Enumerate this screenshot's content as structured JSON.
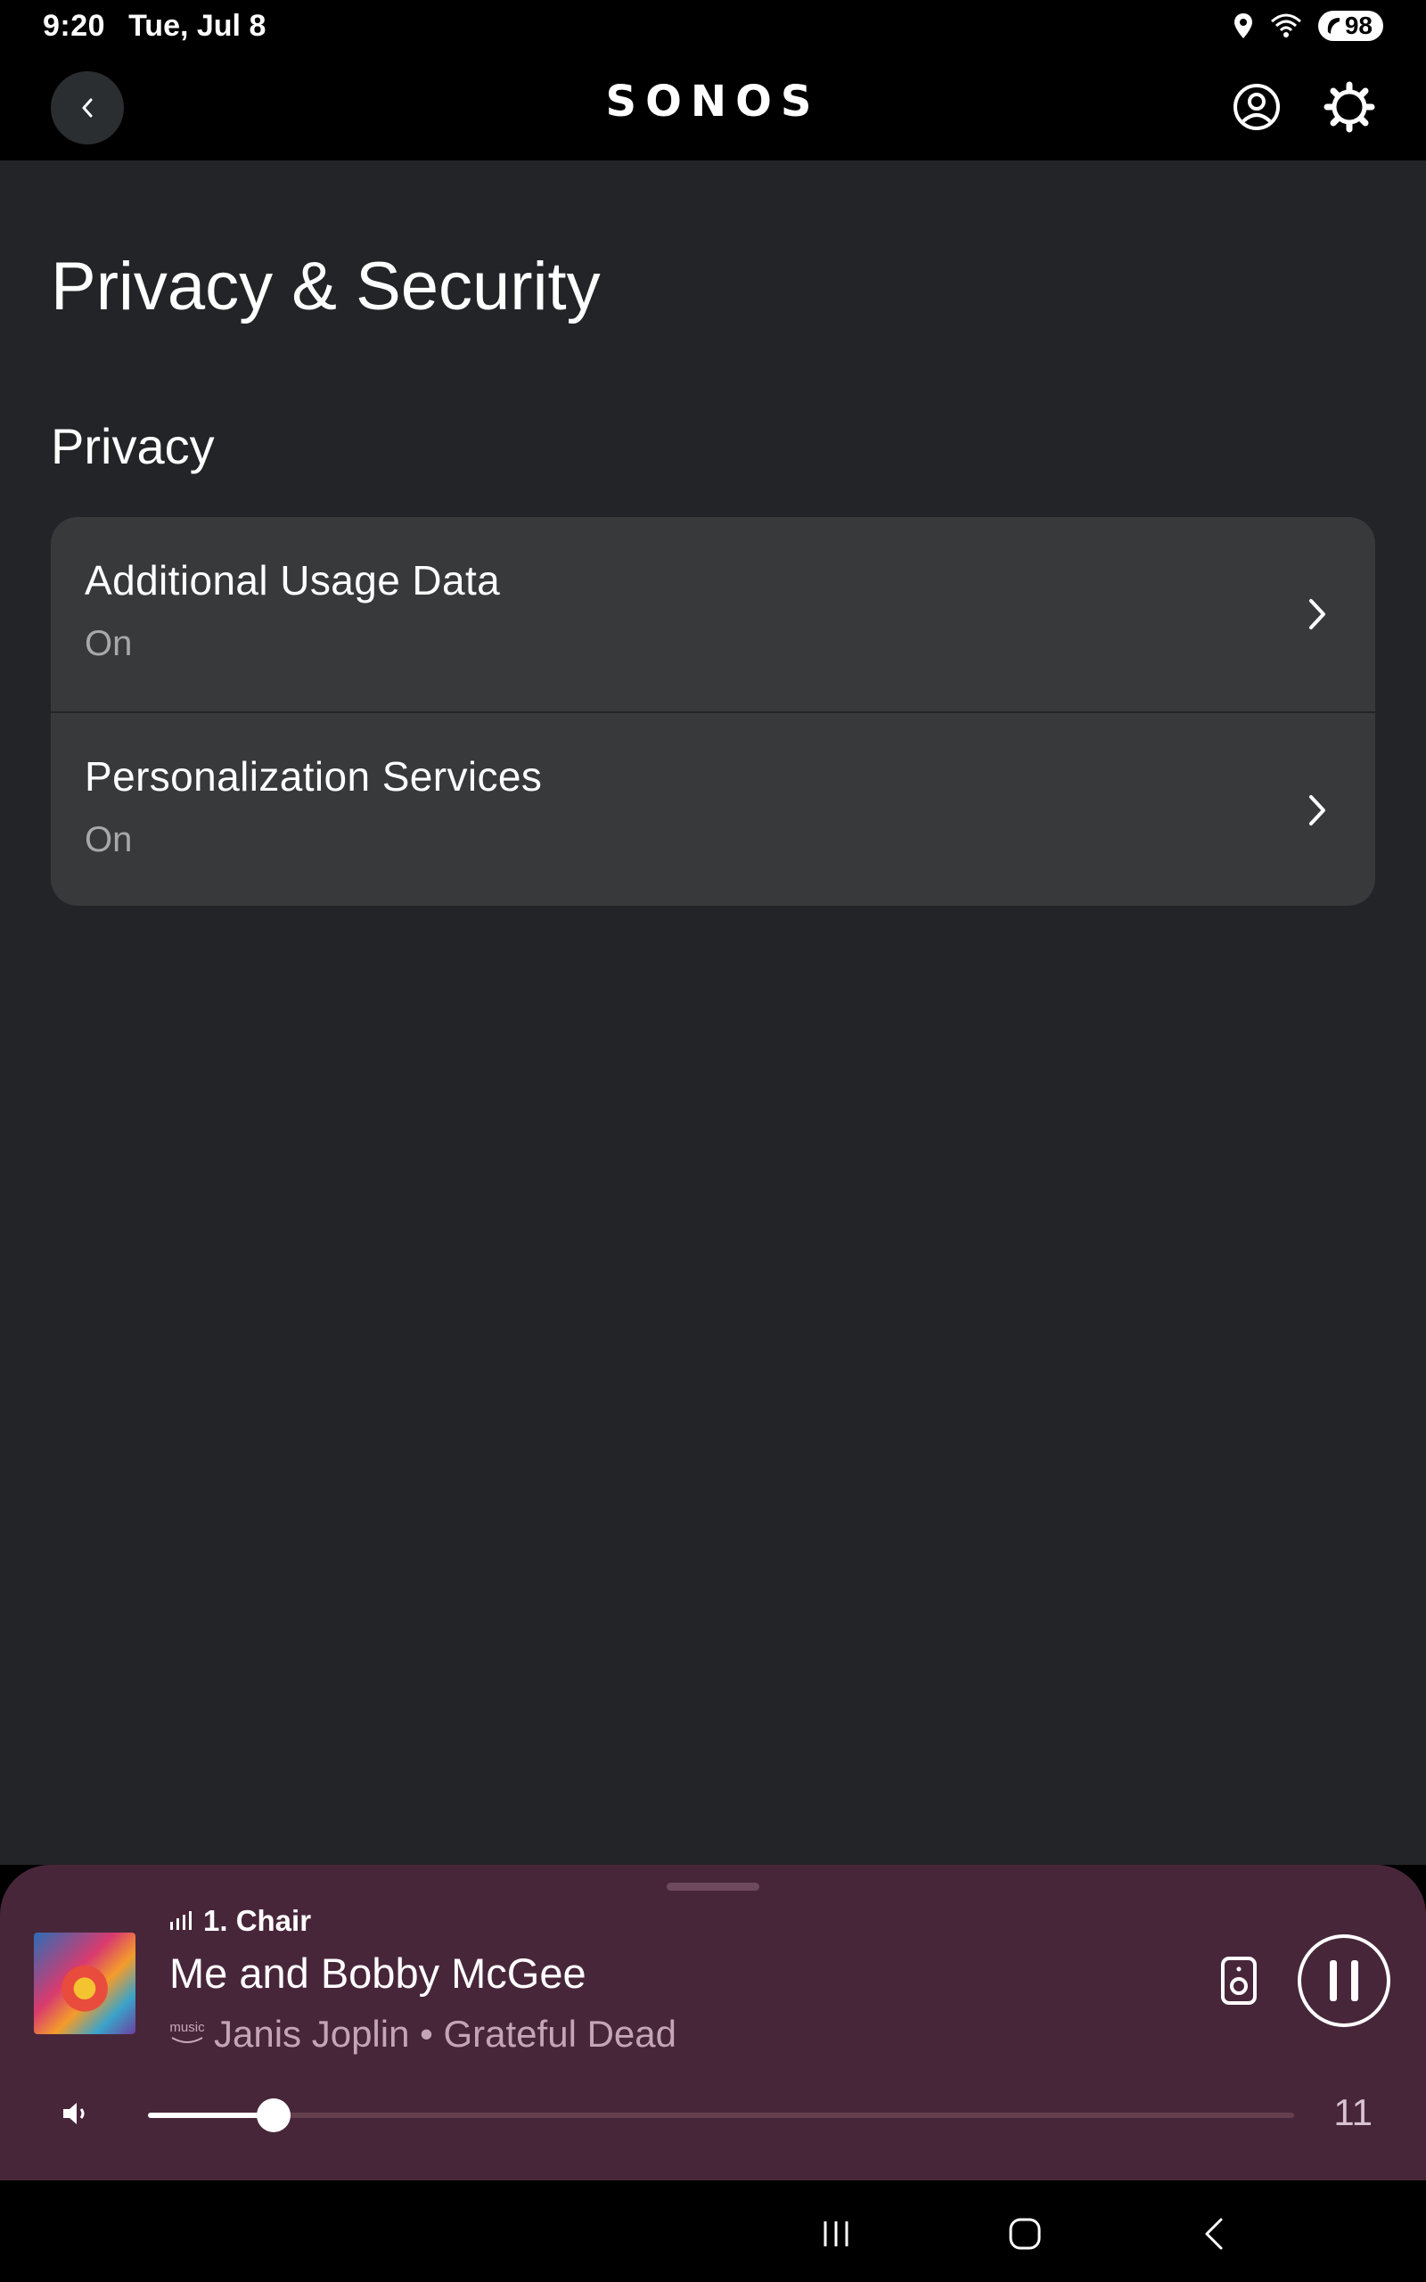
{
  "status_bar": {
    "time": "9:20",
    "date": "Tue, Jul 8",
    "battery": "98"
  },
  "header": {
    "brand": "SONOS",
    "back_icon": "chevron-left-icon",
    "account_icon": "account-icon",
    "settings_icon": "gear-icon"
  },
  "page": {
    "title": "Privacy & Security",
    "section": "Privacy",
    "items": [
      {
        "label": "Additional Usage Data",
        "value": "On"
      },
      {
        "label": "Personalization Services",
        "value": "On"
      }
    ]
  },
  "now_playing": {
    "room": "1. Chair",
    "track": "Me and Bobby McGee",
    "service_logo": "music",
    "artist": "Janis Joplin • Grateful Dead",
    "volume": 11,
    "volume_fraction": 0.11,
    "accent": "#48263a"
  },
  "nav": {
    "recent_icon": "recent-apps-icon",
    "home_icon": "home-icon",
    "back_icon": "back-icon"
  }
}
